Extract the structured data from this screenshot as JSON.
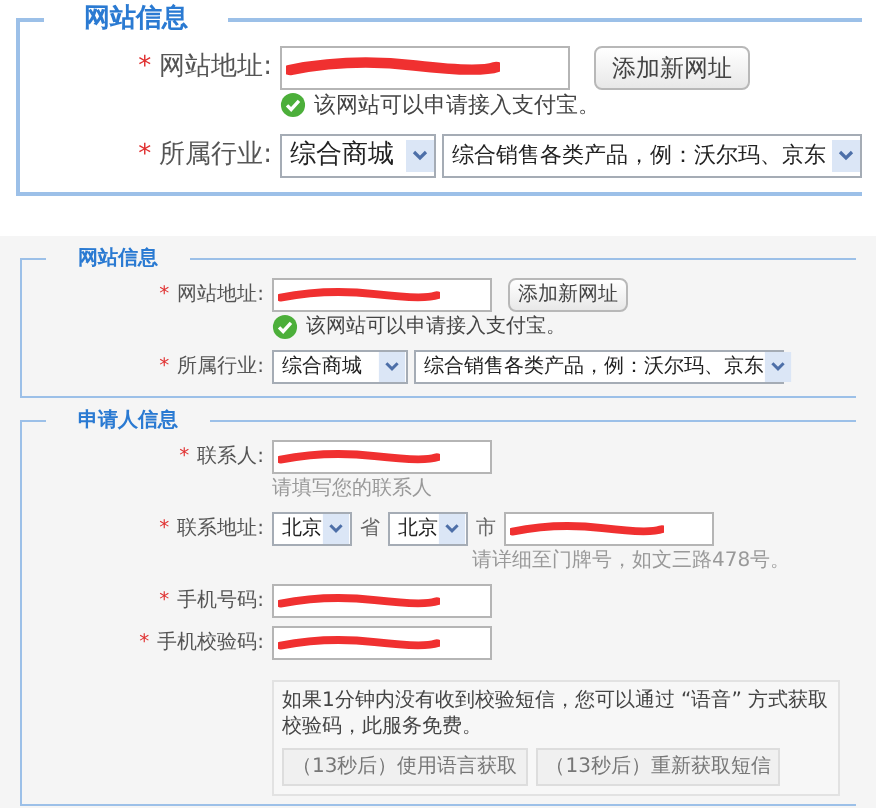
{
  "top_panel": {
    "sections": [
      {
        "legend": "网站信息",
        "fields": [
          {
            "kind": "url",
            "required_mark": "*",
            "label": "网站地址:",
            "redacted": true,
            "button": "添加新网址",
            "hint": "该网站可以申请接入支付宝。",
            "verified": true
          },
          {
            "kind": "selects",
            "required_mark": "*",
            "label": "所属行业:",
            "selects": [
              "综合商城",
              "综合销售各类产品，例：沃尔玛、京东"
            ]
          }
        ]
      }
    ]
  },
  "bottom_panel": {
    "sections": [
      {
        "legend": "网站信息",
        "fields": [
          {
            "kind": "url",
            "required_mark": "*",
            "label": "网站地址:",
            "redacted": true,
            "button": "添加新网址",
            "hint": "该网站可以申请接入支付宝。",
            "verified": true
          },
          {
            "kind": "selects",
            "required_mark": "*",
            "label": "所属行业:",
            "selects": [
              "综合商城",
              "综合销售各类产品，例：沃尔玛、京东"
            ]
          }
        ]
      },
      {
        "legend": "申请人信息",
        "fields": [
          {
            "kind": "text",
            "required_mark": "*",
            "label": "联系人:",
            "redacted": true,
            "hint": "请填写您的联系人"
          },
          {
            "kind": "address",
            "required_mark": "*",
            "label": "联系地址:",
            "province": "北京",
            "province_unit": "省",
            "city": "北京",
            "city_unit": "市",
            "redacted": true,
            "hint": "请详细至门牌号，如文三路478号。"
          },
          {
            "kind": "text",
            "required_mark": "*",
            "label": "手机号码:",
            "redacted": true
          },
          {
            "kind": "text",
            "required_mark": "*",
            "label": "手机校验码:",
            "redacted": true
          },
          {
            "kind": "notice",
            "text": "如果1分钟内没有收到校验短信，您可以通过 “语音” 方式获取校验码，此服务免费。",
            "buttons": [
              "（13秒后）使用语言获取",
              "（13秒后）重新获取短信"
            ]
          }
        ]
      }
    ]
  }
}
